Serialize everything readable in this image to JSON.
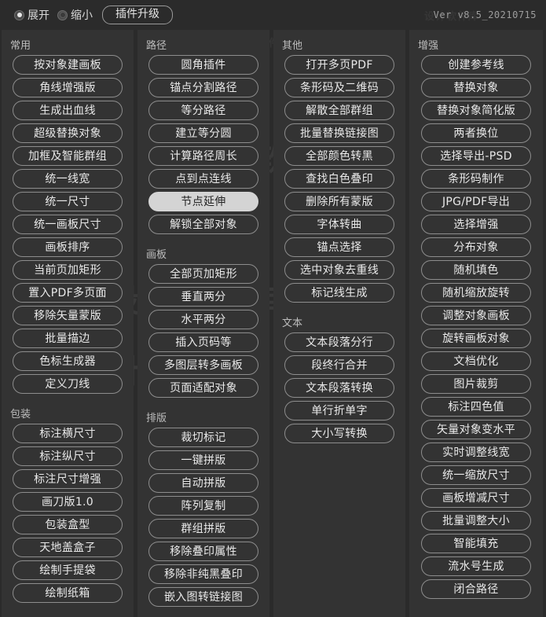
{
  "header": {
    "radio_expand_label": "展开",
    "radio_collapse_label": "缩小",
    "radio_selected": "展开",
    "upgrade_label": "插件升级",
    "version": "Ver v8.5_20210715"
  },
  "watermarks": [
    "设计软件库",
    "众象·设计软件库",
    "众象设计软件库"
  ],
  "theme": {
    "window_bg": "#2b2b2b",
    "panel_bg": "#333333",
    "button_border": "#8d8d8d",
    "button_text": "#e9e9e9",
    "highlight_bg": "#d4d4d4",
    "highlight_text": "#242424",
    "section_title": "#bdbdbd"
  },
  "columns": [
    {
      "name": "column-1",
      "sections": [
        {
          "title": "常用",
          "buttons": [
            "按对象建画板",
            "角线增强版",
            "生成出血线",
            "超级替换对象",
            "加框及智能群组",
            "统一线宽",
            "统一尺寸",
            "统一画板尺寸",
            "画板排序",
            "当前页加矩形",
            "置入PDF多页面",
            "移除矢量蒙版",
            "批量描边",
            "色标生成器",
            "定义刀线"
          ]
        },
        {
          "title": "包装",
          "buttons": [
            "标注横尺寸",
            "标注纵尺寸",
            "标注尺寸增强",
            "画刀版1.0",
            "包装盒型",
            "天地盖盒子",
            "绘制手提袋",
            "绘制纸箱"
          ]
        }
      ]
    },
    {
      "name": "column-2",
      "sections": [
        {
          "title": "路径",
          "buttons": [
            "圆角插件",
            "锚点分割路径",
            "等分路径",
            "建立等分圆",
            "计算路径周长",
            "点到点连线",
            "节点延伸",
            "解锁全部对象"
          ],
          "highlighted": "节点延伸"
        },
        {
          "title": "画板",
          "buttons": [
            "全部页加矩形",
            "垂直两分",
            "水平两分",
            "插入页码等",
            "多图层转多画板",
            "页面适配对象"
          ]
        },
        {
          "title": "排版",
          "buttons": [
            "裁切标记",
            "一键拼版",
            "自动拼版",
            "阵列复制",
            "群组拼版",
            "移除叠印属性",
            "移除非纯黑叠印",
            "嵌入图转链接图"
          ]
        }
      ]
    },
    {
      "name": "column-3",
      "sections": [
        {
          "title": "其他",
          "buttons": [
            "打开多页PDF",
            "条形码及二维码",
            "解散全部群组",
            "批量替换链接图",
            "全部颜色转黑",
            "查找白色叠印",
            "删除所有蒙版",
            "字体转曲",
            "锚点选择",
            "选中对象去重线",
            "标记线生成"
          ]
        },
        {
          "title": "文本",
          "buttons": [
            "文本段落分行",
            "段终行合并",
            "文本段落转换",
            "单行折单字",
            "大小写转换"
          ]
        }
      ]
    },
    {
      "name": "column-4",
      "sections": [
        {
          "title": "增强",
          "buttons": [
            "创建参考线",
            "替换对象",
            "替换对象简化版",
            "两者换位",
            "选择导出-PSD",
            "条形码制作",
            "JPG/PDF导出",
            "选择增强",
            "分布对象",
            "随机填色",
            "随机缩放旋转",
            "调整对象画板",
            "旋转画板对象",
            "文档优化",
            "图片裁剪",
            "标注四色值",
            "矢量对象变水平",
            "实时调整线宽",
            "统一缩放尺寸",
            "画板增减尺寸",
            "批量调整大小",
            "智能填充",
            "流水号生成",
            "闭合路径"
          ]
        }
      ]
    }
  ]
}
